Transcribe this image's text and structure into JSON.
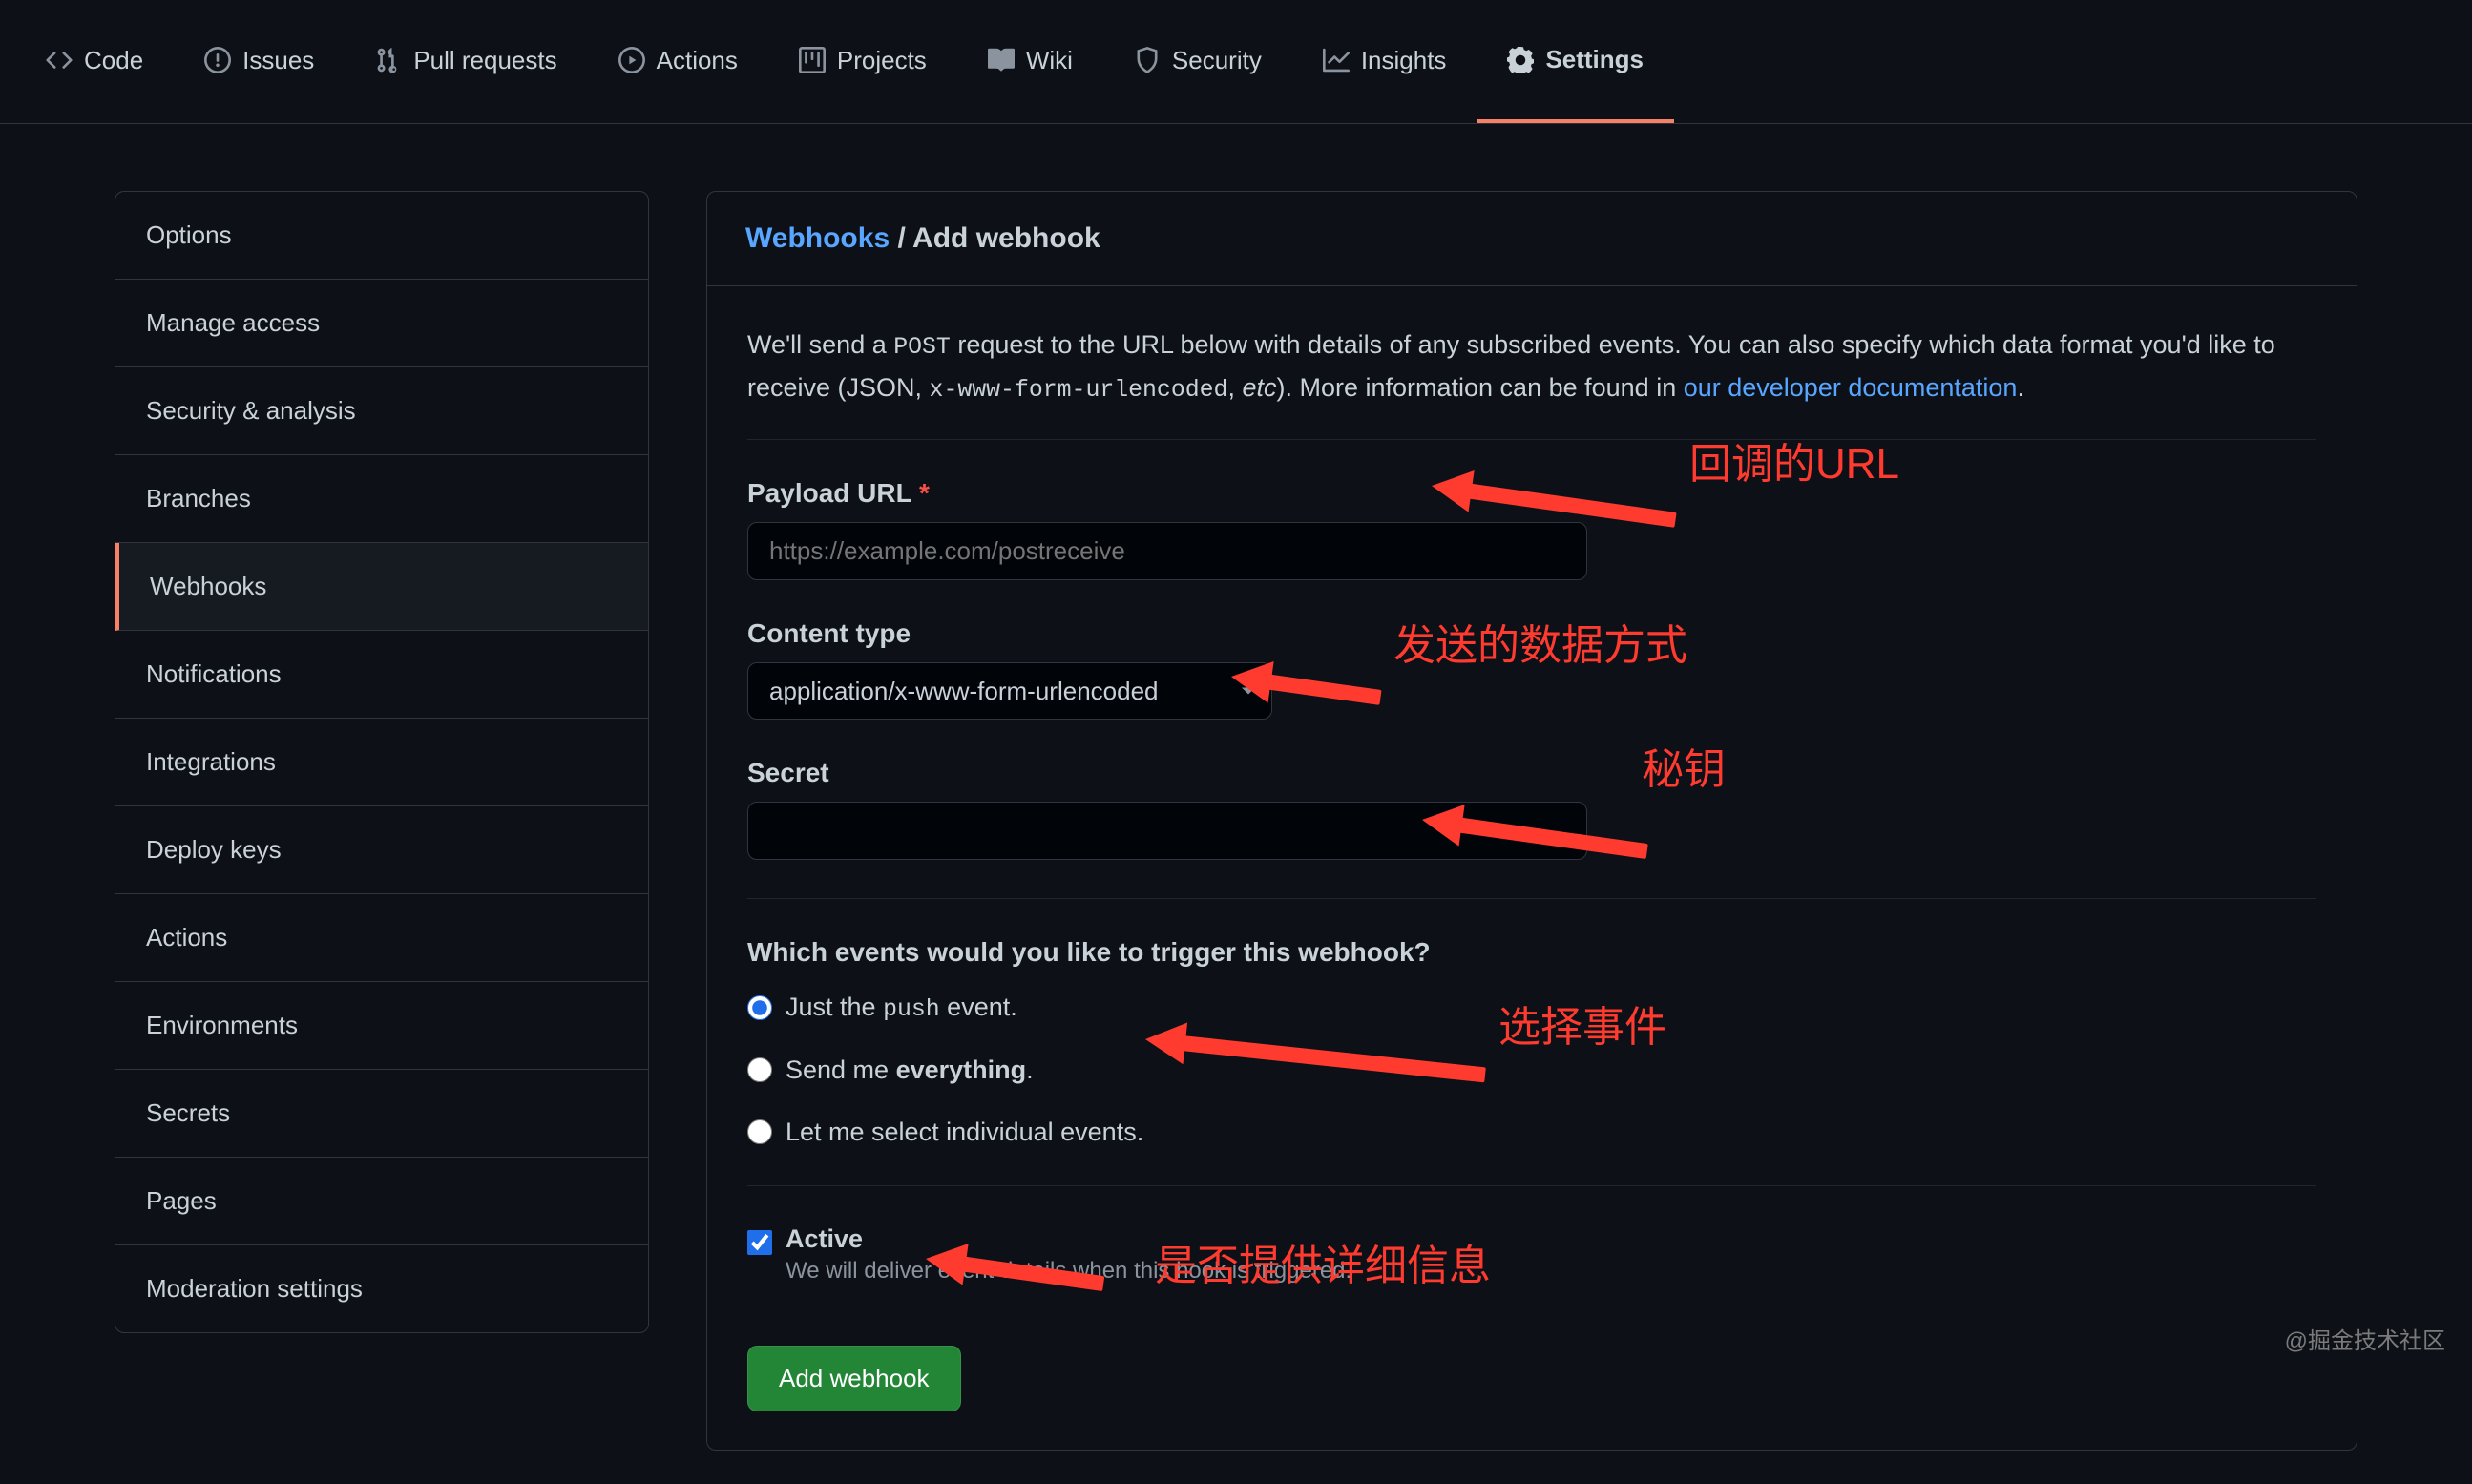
{
  "nav": {
    "tabs": [
      {
        "label": "Code",
        "icon": "code"
      },
      {
        "label": "Issues",
        "icon": "issue"
      },
      {
        "label": "Pull requests",
        "icon": "pr"
      },
      {
        "label": "Actions",
        "icon": "play"
      },
      {
        "label": "Projects",
        "icon": "project"
      },
      {
        "label": "Wiki",
        "icon": "book"
      },
      {
        "label": "Security",
        "icon": "shield"
      },
      {
        "label": "Insights",
        "icon": "graph"
      },
      {
        "label": "Settings",
        "icon": "gear"
      }
    ],
    "selected": "Settings"
  },
  "sidebar": {
    "items": [
      "Options",
      "Manage access",
      "Security & analysis",
      "Branches",
      "Webhooks",
      "Notifications",
      "Integrations",
      "Deploy keys",
      "Actions",
      "Environments",
      "Secrets",
      "Pages",
      "Moderation settings"
    ],
    "active": "Webhooks"
  },
  "breadcrumb": {
    "root": "Webhooks",
    "sep": " / ",
    "current": "Add webhook"
  },
  "description": {
    "part1": "We'll send a ",
    "code1": "POST",
    "part2": " request to the URL below with details of any subscribed events. You can also specify which data format you'd like to receive (JSON, ",
    "code2": "x-www-form-urlencoded",
    "part3": ", ",
    "em": "etc",
    "part4": "). More information can be found in ",
    "link": "our developer documentation",
    "part5": "."
  },
  "form": {
    "payload_url": {
      "label": "Payload URL",
      "placeholder": "https://example.com/postreceive",
      "value": ""
    },
    "content_type": {
      "label": "Content type",
      "selected": "application/x-www-form-urlencoded"
    },
    "secret": {
      "label": "Secret",
      "value": ""
    },
    "events": {
      "heading": "Which events would you like to trigger this webhook?",
      "opt1_pre": "Just the ",
      "opt1_code": "push",
      "opt1_post": " event.",
      "opt2_pre": "Send me ",
      "opt2_strong": "everything",
      "opt2_post": ".",
      "opt3": "Let me select individual events.",
      "selected": "push"
    },
    "active": {
      "label": "Active",
      "note": "We will deliver event details when this hook is triggered.",
      "checked": true
    },
    "submit": "Add webhook"
  },
  "annotations": {
    "url": "回调的URL",
    "content_type": "发送的数据方式",
    "secret": "秘钥",
    "events": "选择事件",
    "active": "是否提供详细信息"
  },
  "watermark": "@掘金技术社区"
}
